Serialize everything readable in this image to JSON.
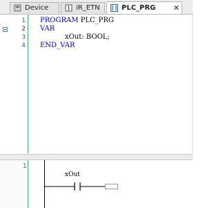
{
  "tabs": [
    {
      "label": "Device",
      "icon": "device-icon",
      "active": false
    },
    {
      "label": "iR_ETN",
      "icon": "network-icon",
      "active": false
    },
    {
      "label": "PLC_PRG",
      "icon": "pou-icon",
      "active": true,
      "close": "✕"
    }
  ],
  "editor": {
    "lines": [
      {
        "num": "1",
        "keyword": "PROGRAM",
        "rest": " PLC_PRG"
      },
      {
        "num": "2",
        "keyword": "VAR",
        "rest": ""
      },
      {
        "num": "3",
        "keyword": "",
        "rest": "xOut: BOOL;"
      },
      {
        "num": "4",
        "keyword": "END_VAR",
        "rest": ""
      }
    ]
  },
  "ladder": {
    "rung_number": "1",
    "contact_variable": "xOut"
  },
  "colors": {
    "keyword": "#0000cc",
    "line_number": "#2b6aa8",
    "current_line_number": "#c00000",
    "gutter_separator": "#3cae73"
  }
}
